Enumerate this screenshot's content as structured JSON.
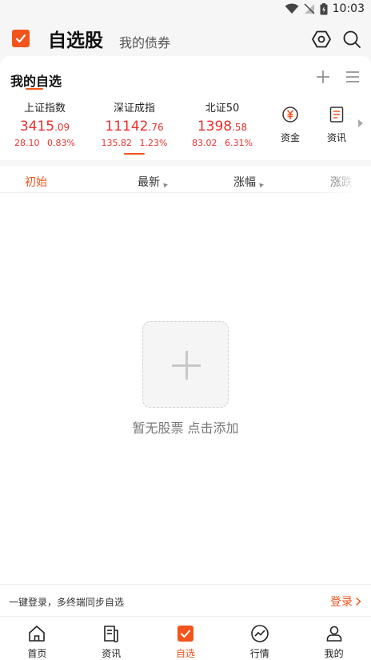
{
  "status": {
    "time": "10:03"
  },
  "header": {
    "title": "自选股",
    "subtitle": "我的债券"
  },
  "watchlist": {
    "title": "我的自选",
    "indices": [
      {
        "name": "上证指数",
        "value_main": "3415",
        "value_dec": ".09",
        "change": "28.10",
        "percent": "0.83%"
      },
      {
        "name": "深证成指",
        "value_main": "11142",
        "value_dec": ".76",
        "change": "135.82",
        "percent": "1.23%"
      },
      {
        "name": "北证50",
        "value_main": "1398",
        "value_dec": ".58",
        "change": "83.02",
        "percent": "6.31%"
      }
    ],
    "quick_buttons": [
      {
        "label": "资金",
        "icon": "yuan-circle-icon"
      },
      {
        "label": "资讯",
        "icon": "document-icon"
      }
    ]
  },
  "table": {
    "columns": [
      "初始",
      "最新",
      "涨幅",
      "涨跌"
    ]
  },
  "empty_state": {
    "hint": "暂无股票 点击添加"
  },
  "login_bar": {
    "text": "一键登录，多终端同步自选",
    "link": "登录"
  },
  "tabbar": {
    "items": [
      {
        "label": "首页",
        "icon": "home-icon"
      },
      {
        "label": "资讯",
        "icon": "news-icon"
      },
      {
        "label": "自选",
        "icon": "watchlist-icon",
        "active": true
      },
      {
        "label": "行情",
        "icon": "market-icon"
      },
      {
        "label": "我的",
        "icon": "user-icon"
      }
    ]
  },
  "colors": {
    "accent": "#f2541b",
    "up": "#e9302d"
  }
}
